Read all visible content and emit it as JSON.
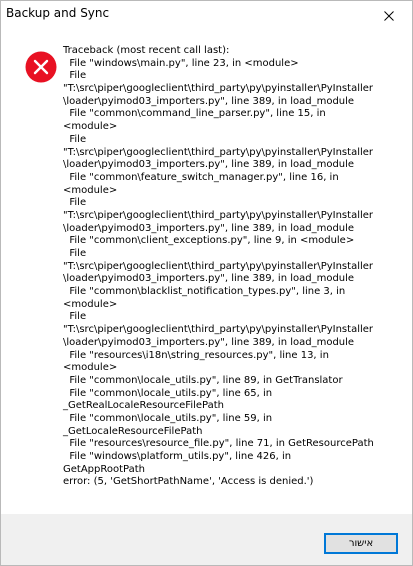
{
  "window": {
    "title": "Backup and Sync",
    "close_icon": "close-icon"
  },
  "dialog": {
    "icon": "error-icon",
    "icon_color": "#e81123",
    "message_lines": [
      "Traceback (most recent call last):",
      "  File \"windows\\main.py\", line 23, in <module>",
      "  File",
      "\"T:\\src\\piper\\googleclient\\third_party\\py\\pyinstaller\\PyInstaller",
      "\\loader\\pyimod03_importers.py\", line 389, in load_module",
      "  File \"common\\command_line_parser.py\", line 15, in",
      "<module>",
      "  File",
      "\"T:\\src\\piper\\googleclient\\third_party\\py\\pyinstaller\\PyInstaller",
      "\\loader\\pyimod03_importers.py\", line 389, in load_module",
      "  File \"common\\feature_switch_manager.py\", line 16, in",
      "<module>",
      "  File",
      "\"T:\\src\\piper\\googleclient\\third_party\\py\\pyinstaller\\PyInstaller",
      "\\loader\\pyimod03_importers.py\", line 389, in load_module",
      "  File \"common\\client_exceptions.py\", line 9, in <module>",
      "  File",
      "\"T:\\src\\piper\\googleclient\\third_party\\py\\pyinstaller\\PyInstaller",
      "\\loader\\pyimod03_importers.py\", line 389, in load_module",
      "  File \"common\\blacklist_notification_types.py\", line 3, in",
      "<module>",
      "  File",
      "\"T:\\src\\piper\\googleclient\\third_party\\py\\pyinstaller\\PyInstaller",
      "\\loader\\pyimod03_importers.py\", line 389, in load_module",
      "  File \"resources\\i18n\\string_resources.py\", line 13, in",
      "<module>",
      "  File \"common\\locale_utils.py\", line 89, in GetTranslator",
      "  File \"common\\locale_utils.py\", line 65, in",
      "_GetRealLocaleResourceFilePath",
      "  File \"common\\locale_utils.py\", line 59, in",
      "_GetLocaleResourceFilePath",
      "  File \"resources\\resource_file.py\", line 71, in GetResourcePath",
      "  File \"windows\\platform_utils.py\", line 426, in",
      "GetAppRootPath",
      "error: (5, 'GetShortPathName', 'Access is denied.')"
    ]
  },
  "footer": {
    "ok_label": "אישור",
    "accent": "#0078d7"
  }
}
